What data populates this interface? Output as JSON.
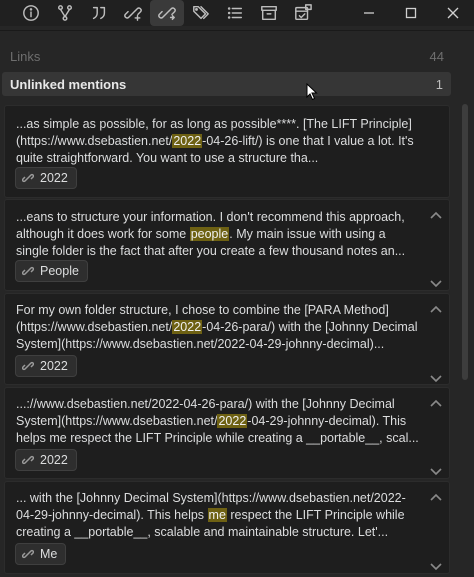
{
  "toolbar": {
    "icons": [
      "info-icon",
      "graph-branch-icon",
      "quote-icon",
      "new-link-icon",
      "outgoing-links-icon",
      "tags-icon",
      "list-icon",
      "archive-icon",
      "calendar-check-icon"
    ]
  },
  "window": {
    "minimize": "minimize-icon",
    "maximize": "maximize-icon",
    "close": "close-icon"
  },
  "links": {
    "label": "Links",
    "count": "44"
  },
  "unlinked": {
    "label": "Unlinked mentions",
    "count": "1"
  },
  "results": [
    {
      "before": "...as simple as possible, for as long as possible****. [The LIFT Principle](https://www.dsebastien.net/",
      "match": "2022",
      "after": "-04-26-lift/) is one that I value a lot. It's quite straightforward. You want to use a structure tha...",
      "tag": "2022"
    },
    {
      "before": "...eans to structure your information. I don't recommend this approach, although it does work for some ",
      "match": "people",
      "after": ". My main issue with using a single folder is the fact that after you create a few thousand notes an...",
      "tag": "People"
    },
    {
      "before": "For my own folder structure, I chose to combine the [PARA Method](https://www.dsebastien.net/",
      "match": "2022",
      "after": "-04-26-para/) with the [Johnny Decimal System](https://www.dsebastien.net/2022-04-29-johnny-decimal)...",
      "tag": "2022"
    },
    {
      "before": "...://www.dsebastien.net/2022-04-26-para/) with the [Johnny Decimal System](https://www.dsebastien.net/",
      "match": "2022",
      "after": "-04-29-johnny-decimal). This helps me respect the LIFT Principle while creating a __portable__, scal...",
      "tag": "2022"
    },
    {
      "before": "... with the [Johnny Decimal System](https://www.dsebastien.net/2022-04-29-johnny-decimal). This helps ",
      "match": "me",
      "after": " respect the LIFT Principle while creating a __portable__, scalable and maintainable structure. Let'...",
      "tag": "Me"
    }
  ]
}
